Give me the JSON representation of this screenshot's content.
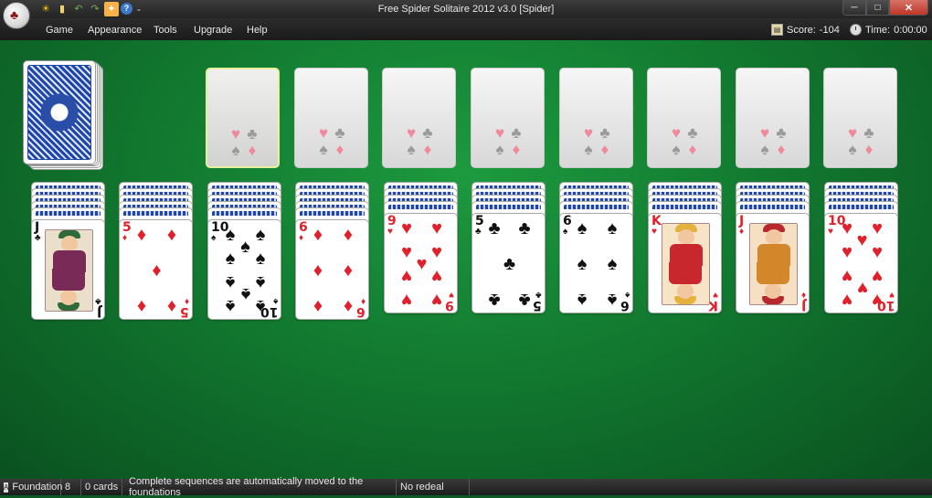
{
  "window": {
    "title": "Free Spider Solitaire 2012 v3.0  [Spider]",
    "app_glyph": "♣",
    "quick_access": [
      {
        "name": "new-game-icon",
        "glyph": "☀"
      },
      {
        "name": "hint-icon",
        "glyph": "▮"
      },
      {
        "name": "undo-icon",
        "glyph": "↶"
      },
      {
        "name": "redo-icon",
        "glyph": "↷"
      },
      {
        "name": "auto-play-icon",
        "glyph": "✦"
      },
      {
        "name": "help-icon",
        "glyph": "?"
      },
      {
        "name": "customize-dropdown-icon",
        "glyph": "⌄"
      }
    ],
    "controls": {
      "minimize": "─",
      "maximize": "□",
      "close": "✕"
    }
  },
  "menu": {
    "items": [
      "Game",
      "Appearance",
      "Tools",
      "Upgrade",
      "Help"
    ],
    "score_label": "Score:",
    "score_value": "-104",
    "time_label": "Time:",
    "time_value": "0:00:00"
  },
  "foundations": [
    {
      "suits": [
        "♥",
        "♣",
        "♠",
        "♦"
      ]
    },
    {
      "suits": [
        "♥",
        "♣",
        "♠",
        "♦"
      ]
    },
    {
      "suits": [
        "♥",
        "♣",
        "♠",
        "♦"
      ]
    },
    {
      "suits": [
        "♥",
        "♣",
        "♠",
        "♦"
      ]
    },
    {
      "suits": [
        "♥",
        "♣",
        "♠",
        "♦"
      ]
    },
    {
      "suits": [
        "♥",
        "♣",
        "♠",
        "♦"
      ]
    },
    {
      "suits": [
        "♥",
        "♣",
        "♠",
        "♦"
      ]
    },
    {
      "suits": [
        "♥",
        "♣",
        "♠",
        "♦"
      ]
    }
  ],
  "tableau": [
    {
      "facedown": 5,
      "card": {
        "rank": "J",
        "suit": "♣",
        "color": "black",
        "court": true
      }
    },
    {
      "facedown": 5,
      "card": {
        "rank": "5",
        "suit": "♦",
        "color": "red",
        "court": false
      }
    },
    {
      "facedown": 5,
      "card": {
        "rank": "10",
        "suit": "♠",
        "color": "black",
        "court": false
      }
    },
    {
      "facedown": 5,
      "card": {
        "rank": "6",
        "suit": "♦",
        "color": "red",
        "court": false
      }
    },
    {
      "facedown": 4,
      "card": {
        "rank": "9",
        "suit": "♥",
        "color": "red",
        "court": false
      }
    },
    {
      "facedown": 4,
      "card": {
        "rank": "5",
        "suit": "♣",
        "color": "black",
        "court": false
      }
    },
    {
      "facedown": 4,
      "card": {
        "rank": "6",
        "suit": "♠",
        "color": "black",
        "court": false
      }
    },
    {
      "facedown": 4,
      "card": {
        "rank": "K",
        "suit": "♥",
        "color": "red",
        "court": true
      }
    },
    {
      "facedown": 4,
      "card": {
        "rank": "J",
        "suit": "♦",
        "color": "red",
        "court": true
      }
    },
    {
      "facedown": 4,
      "card": {
        "rank": "10",
        "suit": "♥",
        "color": "red",
        "court": false
      }
    }
  ],
  "status": {
    "foundation_label": "Foundation",
    "foundation_count": "8",
    "cards": "0 cards",
    "message": "Complete sequences are automatically moved to the foundations",
    "redeal": "No redeal"
  }
}
